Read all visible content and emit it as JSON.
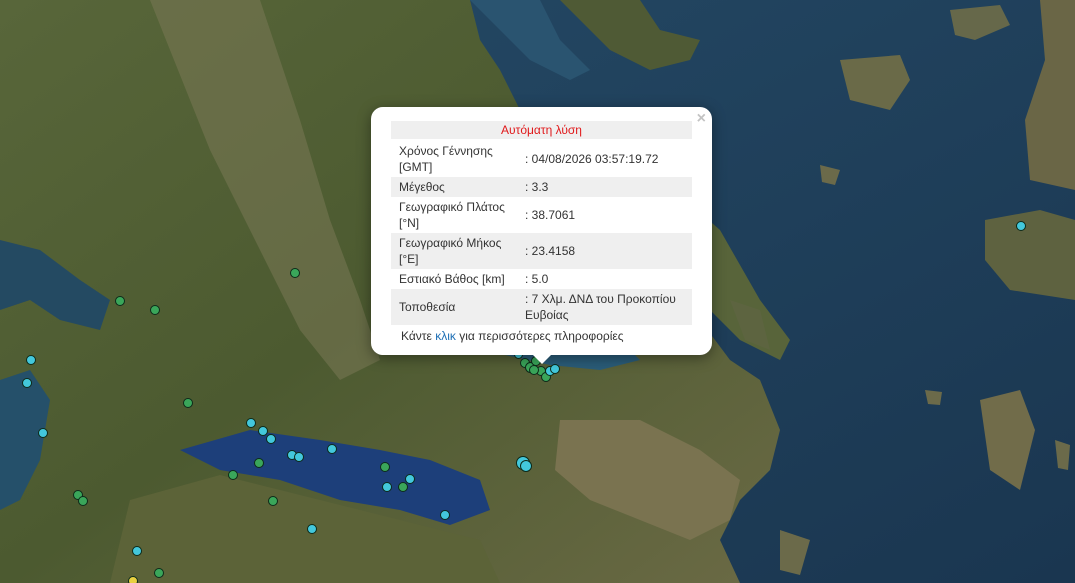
{
  "popup": {
    "title": "Αυτόματη λύση",
    "close_glyph": "×",
    "rows": [
      {
        "label": "Χρόνος Γέννησης [GMT]",
        "value": ": 04/08/2026 03:57:19.72"
      },
      {
        "label": "Μέγεθος",
        "value": ": 3.3"
      },
      {
        "label": "Γεωγραφικό Πλάτος [°N]",
        "value": ": 38.7061"
      },
      {
        "label": "Γεωγραφικό Μήκος [°E]",
        "value": ": 23.4158"
      },
      {
        "label": "Εστιακό Βάθος [km]",
        "value": ": 5.0"
      },
      {
        "label": "Τοποθεσία",
        "value": ": 7 Χλμ. ΔΝΔ του Προκοπίου Ευβοίας"
      }
    ],
    "more_prefix": "Κάντε ",
    "more_link": "κλικ",
    "more_suffix": " για περισσότερες πληροφορίες"
  },
  "colors": {
    "sea": "#1f3f58",
    "land": "#4a5a32",
    "marker_green": "#3aa65a",
    "marker_cyan": "#43c8dc",
    "marker_yellow": "#e8d040",
    "popup_title": "#e0191b",
    "link": "#1e6fb5"
  }
}
